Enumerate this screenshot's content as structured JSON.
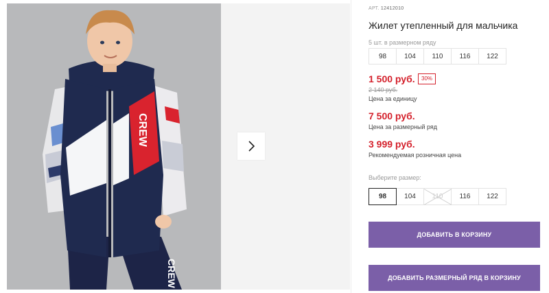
{
  "gallery": {
    "photo_alt": "",
    "next_icon": "chevron-right-icon",
    "jacket_print": "CREW"
  },
  "product": {
    "article_label": "АРТ.",
    "article_number": "12412010",
    "title": "Жилет утепленный для мальчика",
    "row_caption": "5 шт. в размерном ряду",
    "row_sizes": [
      "98",
      "104",
      "110",
      "116",
      "122"
    ],
    "price": "1 500 руб.",
    "discount_badge": "30%",
    "old_price": "2 140 руб.",
    "price_caption": "Цена за единицу",
    "row_price": "7 500 руб.",
    "row_price_caption": "Цена за размерный ряд",
    "retail_price": "3 999 руб.",
    "retail_price_caption": "Рекомендуемая розничная цена",
    "choose_size_label": "Выберите размер:",
    "select_sizes": [
      {
        "label": "98",
        "state": "selected"
      },
      {
        "label": "104",
        "state": "available"
      },
      {
        "label": "110",
        "state": "unavailable"
      },
      {
        "label": "116",
        "state": "available"
      },
      {
        "label": "122",
        "state": "available"
      }
    ],
    "add_to_cart": "ДОБАВИТЬ В КОРЗИНУ",
    "add_row_to_cart": "ДОБАВИТЬ РАЗМЕРНЫЙ РЯД В КОРЗИНУ"
  },
  "colors": {
    "accent": "#7b5fa8",
    "price_red": "#d4202b",
    "vest_navy": "#1f2a4f",
    "vest_red": "#d9232e"
  }
}
